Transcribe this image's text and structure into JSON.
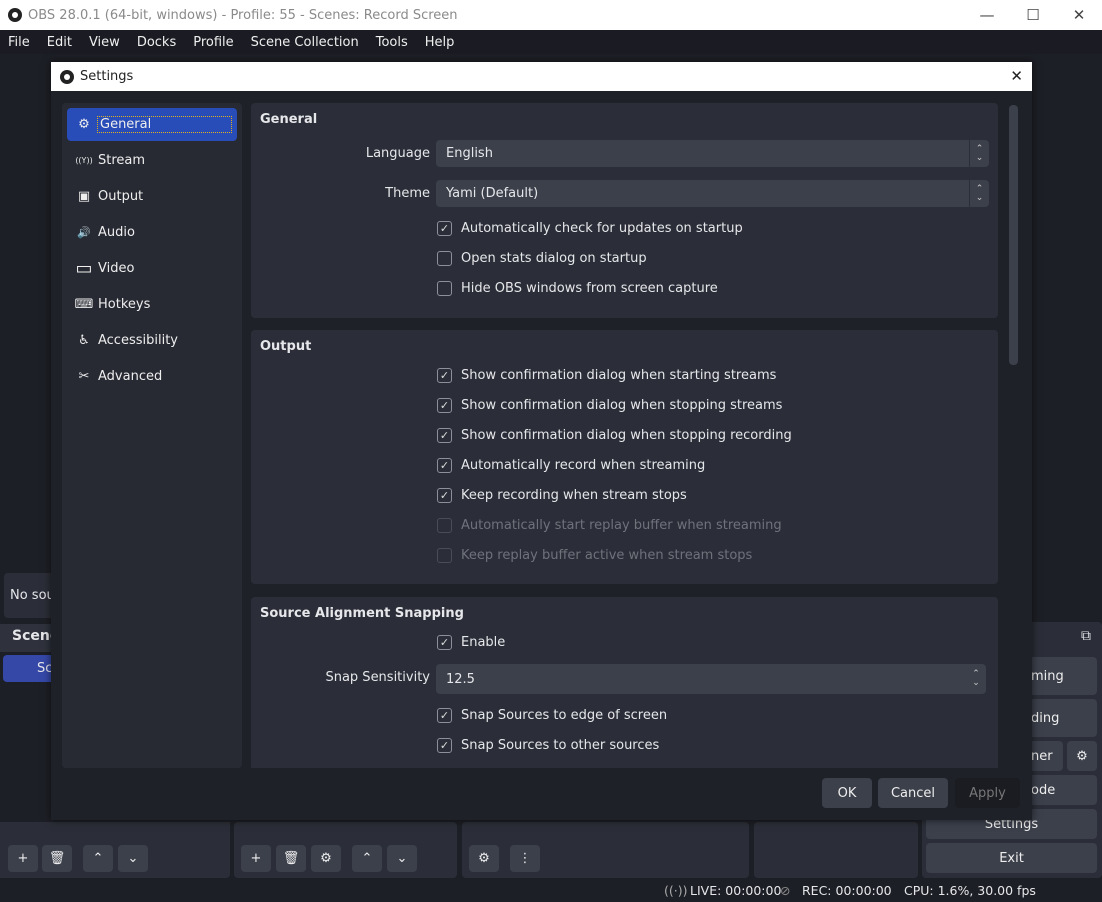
{
  "window": {
    "title": "OBS 28.0.1 (64-bit, windows) - Profile: 55 - Scenes: Record Screen",
    "minimize": "—",
    "maximize": "☐",
    "close": "✕"
  },
  "menu": [
    "File",
    "Edit",
    "View",
    "Docks",
    "Profile",
    "Scene Collection",
    "Tools",
    "Help"
  ],
  "main": {
    "sources_empty": "No sou",
    "scenes_header": "Scene",
    "scene_item": "Sc",
    "controls": {
      "streaming": "ming",
      "recording": "ding",
      "virtual_camera": "ner",
      "studio_mode": "ode",
      "settings": "Settings",
      "exit": "Exit"
    },
    "status": {
      "live": "LIVE: 00:00:00",
      "rec": "REC: 00:00:00",
      "cpu": "CPU: 1.6%, 30.00 fps"
    }
  },
  "dialog": {
    "title": "Settings",
    "close": "✕",
    "nav": [
      {
        "label": "General",
        "icon": "gear-icon",
        "glyph": "⚙"
      },
      {
        "label": "Stream",
        "icon": "antenna-icon",
        "glyph": "((Y))"
      },
      {
        "label": "Output",
        "icon": "output-icon",
        "glyph": "▣"
      },
      {
        "label": "Audio",
        "icon": "speaker-icon",
        "glyph": "🔊"
      },
      {
        "label": "Video",
        "icon": "monitor-icon",
        "glyph": "▭"
      },
      {
        "label": "Hotkeys",
        "icon": "keyboard-icon",
        "glyph": "⌨"
      },
      {
        "label": "Accessibility",
        "icon": "accessibility-icon",
        "glyph": "♿"
      },
      {
        "label": "Advanced",
        "icon": "tools-icon",
        "glyph": "✂"
      }
    ],
    "general": {
      "title": "General",
      "language_label": "Language",
      "language": "English",
      "theme_label": "Theme",
      "theme": "Yami (Default)",
      "checks": [
        {
          "label": "Automatically check for updates on startup",
          "checked": true
        },
        {
          "label": "Open stats dialog on startup",
          "checked": false
        },
        {
          "label": "Hide OBS windows from screen capture",
          "checked": false
        }
      ]
    },
    "output": {
      "title": "Output",
      "checks": [
        {
          "label": "Show confirmation dialog when starting streams",
          "checked": true,
          "enabled": true
        },
        {
          "label": "Show confirmation dialog when stopping streams",
          "checked": true,
          "enabled": true
        },
        {
          "label": "Show confirmation dialog when stopping recording",
          "checked": true,
          "enabled": true
        },
        {
          "label": "Automatically record when streaming",
          "checked": true,
          "enabled": true
        },
        {
          "label": "Keep recording when stream stops",
          "checked": true,
          "enabled": true
        },
        {
          "label": "Automatically start replay buffer when streaming",
          "checked": false,
          "enabled": false
        },
        {
          "label": "Keep replay buffer active when stream stops",
          "checked": false,
          "enabled": false
        }
      ]
    },
    "snapping": {
      "title": "Source Alignment Snapping",
      "enable": "Enable",
      "sensitivity_label": "Snap Sensitivity",
      "sensitivity": "12.5",
      "checks": [
        {
          "label": "Snap Sources to edge of screen",
          "checked": true
        },
        {
          "label": "Snap Sources to other sources",
          "checked": true
        }
      ]
    },
    "buttons": {
      "ok": "OK",
      "cancel": "Cancel",
      "apply": "Apply"
    }
  },
  "colors": {
    "accent": "#284cb8",
    "panel": "#2b2e38",
    "input": "#3c404b"
  }
}
